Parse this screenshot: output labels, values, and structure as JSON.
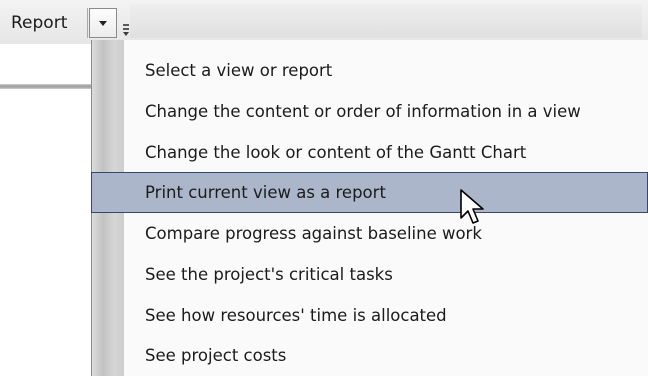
{
  "toolbar": {
    "report_label": "Report",
    "dropdown_icon": "chevron-down-icon",
    "grip_icon": "toolbar-options-icon"
  },
  "menu": {
    "items": [
      {
        "label": "Select a view or report"
      },
      {
        "label": "Change the content or order of information in a view"
      },
      {
        "label": "Change the look or content of the Gantt Chart"
      },
      {
        "label": "Print current view as a report",
        "highlighted": true
      },
      {
        "label": "Compare progress against baseline work"
      },
      {
        "label": "See the project's critical tasks"
      },
      {
        "label": "See how resources' time is allocated"
      },
      {
        "label": "See project costs"
      }
    ]
  },
  "colors": {
    "highlight_fill": "#acb6cb",
    "highlight_border": "#36496a"
  }
}
